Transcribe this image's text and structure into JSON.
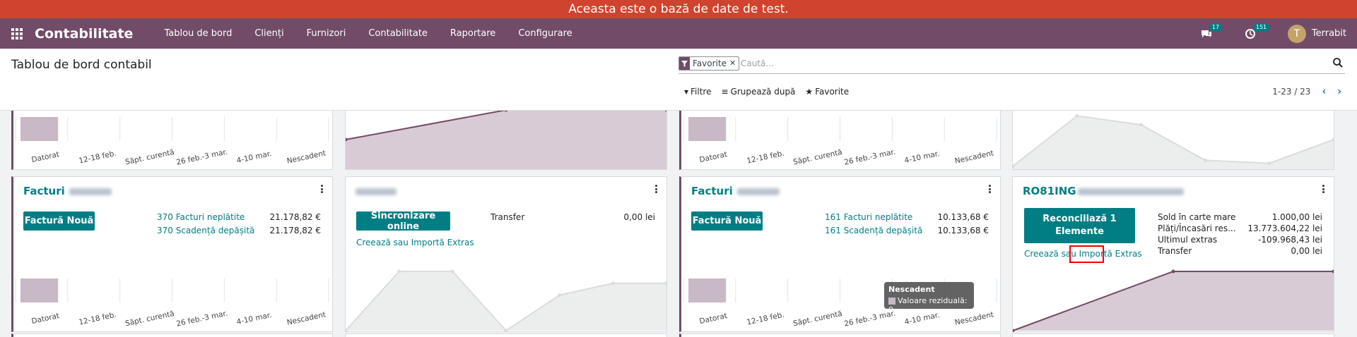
{
  "banner": "Aceasta este o bază de date de test.",
  "navbar": {
    "brand": "Contabilitate",
    "menu": [
      "Tablou de bord",
      "Clienți",
      "Furnizori",
      "Contabilitate",
      "Raportare",
      "Configurare"
    ],
    "messages_count": "17",
    "activities_count": "151",
    "user_initial": "T",
    "user_name": "Terrabit"
  },
  "control_panel": {
    "title": "Tablou de bord contabil",
    "facet": "Favorite",
    "search_placeholder": "Caută...",
    "filters": "Filtre",
    "group_by": "Grupează după",
    "favorites": "Favorite",
    "pager": "1-23 / 23"
  },
  "chart_ticks": [
    "Datorat",
    "12-18 feb.",
    "Săpt. curentă",
    "26 feb.-3 mar.",
    "4-10 mar.",
    "Nescadent"
  ],
  "cards": {
    "sales1": {
      "title": "Facturi",
      "new_invoice": "Factură Nouă",
      "unpaid": "370 Facturi neplătite",
      "unpaid_amount": "21.178,82 €",
      "overdue": "370 Scadență depășită",
      "overdue_amount": "21.178,82 €"
    },
    "online": {
      "sync": "Sincronizare online",
      "transfer_label": "Transfer",
      "transfer_amount": "0,00 lei",
      "create_import": "Creează sau Importă Extras"
    },
    "sales2": {
      "title": "Facturi",
      "new_invoice": "Factură Nouă",
      "unpaid": "161 Facturi neplătite",
      "unpaid_amount": "10.133,68 €",
      "overdue": "161 Scadență depășită",
      "overdue_amount": "10.133,68 €"
    },
    "bank": {
      "title": "RO81ING",
      "reconcile": "Reconciliază 1 Elemente",
      "create_prefix": "Creează sau ",
      "import_word": "Importă",
      "extras_word": " Extras",
      "ledger_label": "Sold în carte mare",
      "ledger_amount": "1.000,00 lei",
      "payments_label": "Plăți/Încasări res...",
      "payments_amount": "13.773.604,22 lei",
      "last_label": "Ultimul extras",
      "last_amount": "-109.968,43 lei",
      "transfer_label": "Transfer",
      "transfer_amount": "0,00 lei"
    }
  },
  "tooltip": {
    "title": "Nescadent",
    "label": "Valoare reziduală: 0"
  },
  "colors": {
    "banner": "#d0432e",
    "navbar": "#714b67",
    "accent": "#017e84",
    "bar": "#c9b8c5"
  },
  "chart_data": [
    {
      "type": "bar",
      "categories": [
        "Datorat",
        "12-18 feb.",
        "Săpt. curentă",
        "26 feb.-3 mar.",
        "4-10 mar.",
        "Nescadent"
      ],
      "values": [
        1,
        0,
        0,
        0,
        0,
        0
      ]
    },
    {
      "type": "area",
      "x": [
        1,
        2,
        3
      ],
      "values": [
        0.5,
        1,
        1
      ]
    },
    {
      "type": "bar",
      "categories": [
        "Datorat",
        "12-18 feb.",
        "Săpt. curentă",
        "26 feb.-3 mar.",
        "4-10 mar.",
        "Nescadent"
      ],
      "values": [
        1,
        0,
        0,
        0,
        0,
        0
      ]
    },
    {
      "type": "line",
      "x": [
        1,
        2,
        3,
        4,
        5,
        6
      ],
      "values": [
        0.05,
        0.9,
        0.75,
        0.15,
        0.1,
        0.5
      ]
    },
    {
      "type": "bar",
      "categories": [
        "Datorat",
        "12-18 feb.",
        "Săpt. curentă",
        "26 feb.-3 mar.",
        "4-10 mar.",
        "Nescadent"
      ],
      "values": [
        1,
        0,
        0,
        0,
        0,
        0
      ]
    },
    {
      "type": "line",
      "x": [
        1,
        2,
        3,
        4,
        5,
        6,
        7
      ],
      "values": [
        0.0,
        1.0,
        1.0,
        0.0,
        0.6,
        0.8,
        0.8
      ]
    },
    {
      "type": "bar",
      "categories": [
        "Datorat",
        "12-18 feb.",
        "Săpt. curentă",
        "26 feb.-3 mar.",
        "4-10 mar.",
        "Nescadent"
      ],
      "values": [
        1,
        0,
        0,
        0,
        0,
        0
      ]
    },
    {
      "type": "area",
      "x": [
        1,
        2,
        3
      ],
      "values": [
        0.0,
        1,
        1
      ]
    }
  ]
}
